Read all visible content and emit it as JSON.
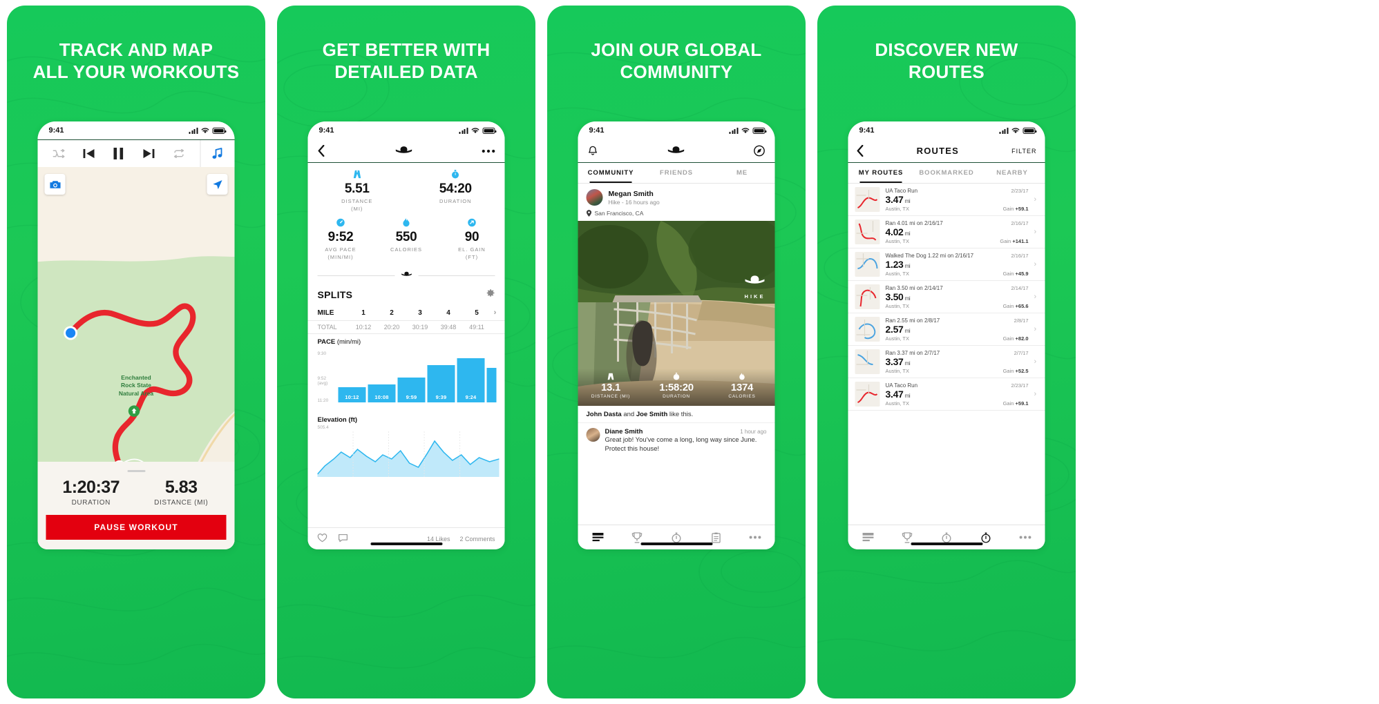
{
  "theme": {
    "brand_green": "#17c95a",
    "accent_blue": "#2eb7ef",
    "pause_red": "#e3000f",
    "route_red": "#e8262d",
    "dark_green_rule": "#1e4f35"
  },
  "panels": [
    {
      "headline_line1": "TRACK AND MAP",
      "headline_line2": "ALL YOUR WORKOUTS",
      "status_time": "9:41",
      "media_controls": [
        "shuffle-icon",
        "previous-track-icon",
        "pause-icon",
        "next-track-icon",
        "repeat-icon",
        "music-note-icon"
      ],
      "map": {
        "park_label_line1": "Enchanted",
        "park_label_line2": "Rock State",
        "park_label_line3": "Natural Area",
        "camera_button": "camera-icon",
        "locate_button": "navigate-icon"
      },
      "stats": [
        {
          "value": "1:20:37",
          "label": "DURATION"
        },
        {
          "value": "5.83",
          "label": "DISTANCE (MI)"
        }
      ],
      "pause_button": "PAUSE WORKOUT"
    },
    {
      "headline_line1": "GET BETTER WITH",
      "headline_line2": "DETAILED DATA",
      "status_time": "9:41",
      "nav": {
        "back": "back-chevron-icon",
        "logo": "under-armour-logo",
        "more": "more-dots-icon"
      },
      "summary_top": [
        {
          "icon": "road-icon",
          "value": "5.51",
          "label1": "DISTANCE",
          "label2": "(MI)"
        },
        {
          "icon": "stopwatch-icon",
          "value": "54:20",
          "label1": "DURATION",
          "label2": ""
        }
      ],
      "summary_mid": [
        {
          "icon": "speedometer-icon",
          "value": "9:52",
          "label1": "AVG PACE",
          "label2": "(MIN/MI)"
        },
        {
          "icon": "flame-icon",
          "value": "550",
          "label1": "CALORIES",
          "label2": ""
        },
        {
          "icon": "elevation-icon",
          "value": "90",
          "label1": "EL. GAIN",
          "label2": "(FT)"
        }
      ],
      "splits": {
        "title": "SPLITS",
        "settings_icon": "gear-icon",
        "header_label": "MILE",
        "columns": [
          "1",
          "2",
          "3",
          "4",
          "5"
        ],
        "total_label": "TOTAL",
        "totals": [
          "10:12",
          "20:20",
          "30:19",
          "39:48",
          "49:11"
        ],
        "pace_title": "PACE",
        "pace_unit": "(min/mi)",
        "y_ticks": [
          "9:30",
          "9:52 (avg)",
          "11:20"
        ],
        "bar_labels": [
          "10:12",
          "10:08",
          "9:59",
          "9:39",
          "9:24"
        ],
        "elevation_title": "Elevation",
        "elevation_unit": "(ft)",
        "elevation_tick": "505.4"
      },
      "action_bar": {
        "like_icon": "heart-icon",
        "comment_icon": "speech-bubble-icon",
        "likes": "14 Likes",
        "comments": "2 Comments"
      }
    },
    {
      "headline_line1": "JOIN OUR GLOBAL",
      "headline_line2": "COMMUNITY",
      "status_time": "9:41",
      "nav": {
        "bell": "notification-bell-icon",
        "logo": "under-armour-logo",
        "compass": "compass-icon"
      },
      "tabs": [
        {
          "label": "COMMUNITY",
          "active": true
        },
        {
          "label": "FRIENDS",
          "active": false
        },
        {
          "label": "ME",
          "active": false
        }
      ],
      "post": {
        "author": "Megan Smith",
        "meta": "Hike - 16 hours ago",
        "location": "San Francisco, CA",
        "photo_badge": "HIKE",
        "photo_stats": [
          {
            "icon": "road-icon",
            "value": "13.1",
            "label": "DISTANCE (MI)"
          },
          {
            "icon": "stopwatch-icon",
            "value": "1:58:20",
            "label": "DURATION"
          },
          {
            "icon": "flame-icon",
            "value": "1374",
            "label": "CALORIES"
          }
        ],
        "likes_prefix": "John Dasta",
        "likes_join": " and ",
        "likes_second": "Joe Smith",
        "likes_suffix": " like this.",
        "comment": {
          "author": "Diane Smith",
          "time": "1 hour ago",
          "text": "Great job! You've come a long, long way since June. Protect this house!"
        }
      },
      "tab_bar": [
        "feed-icon",
        "trophy-icon",
        "stopwatch-icon",
        "clipboard-icon",
        "more-dots-icon"
      ]
    },
    {
      "headline_line1": "DISCOVER NEW",
      "headline_line2": "ROUTES",
      "status_time": "9:41",
      "nav": {
        "back": "back-chevron-icon",
        "title": "ROUTES",
        "filter": "FILTER"
      },
      "tabs": [
        {
          "label": "MY ROUTES",
          "active": true
        },
        {
          "label": "BOOKMARKED",
          "active": false
        },
        {
          "label": "NEARBY",
          "active": false
        }
      ],
      "routes": [
        {
          "name": "UA Taco Run",
          "date": "2/23/17",
          "distance": "3.47",
          "unit": "mi",
          "city": "Austin, TX",
          "gain_label": "Gain ",
          "gain": "+59.1"
        },
        {
          "name": "Ran 4.01 mi on 2/16/17",
          "date": "2/16/17",
          "distance": "4.02",
          "unit": "mi",
          "city": "Austin, TX",
          "gain_label": "Gain ",
          "gain": "+141.1"
        },
        {
          "name": "Walked The Dog 1.22 mi on 2/16/17",
          "date": "2/16/17",
          "distance": "1.23",
          "unit": "mi",
          "city": "Austin, TX",
          "gain_label": "Gain ",
          "gain": "+45.9"
        },
        {
          "name": "Ran 3.50 mi on 2/14/17",
          "date": "2/14/17",
          "distance": "3.50",
          "unit": "mi",
          "city": "Austin, TX",
          "gain_label": "Gain ",
          "gain": "+65.6"
        },
        {
          "name": "Ran 2.55 mi on 2/8/17",
          "date": "2/8/17",
          "distance": "2.57",
          "unit": "mi",
          "city": "Austin, TX",
          "gain_label": "Gain ",
          "gain": "+82.0"
        },
        {
          "name": "Ran 3.37 mi on 2/7/17",
          "date": "2/7/17",
          "distance": "3.37",
          "unit": "mi",
          "city": "Austin, TX",
          "gain_label": "Gain ",
          "gain": "+52.5"
        },
        {
          "name": "UA Taco Run",
          "date": "2/23/17",
          "distance": "3.47",
          "unit": "mi",
          "city": "Austin, TX",
          "gain_label": "Gain ",
          "gain": "+59.1"
        }
      ],
      "tab_bar": [
        "feed-icon",
        "trophy-icon",
        "stopwatch-icon",
        "route-icon",
        "more-dots-icon"
      ]
    }
  ],
  "chart_data": [
    {
      "type": "bar",
      "title": "PACE",
      "ylabel": "(min/mi)",
      "categories": [
        "1",
        "2",
        "3",
        "4",
        "5"
      ],
      "values": [
        "10:12",
        "10:08",
        "9:59",
        "9:39",
        "9:24"
      ],
      "y_ticks": [
        "9:30",
        "9:52 (avg)",
        "11:20"
      ],
      "xlabel": "MILE",
      "legend": "none",
      "grid": false
    },
    {
      "type": "area",
      "title": "Elevation",
      "ylabel": "(ft)",
      "y_ticks": [
        "505.4"
      ],
      "x": [
        0,
        1,
        2,
        3,
        4,
        5,
        6,
        7,
        8,
        9,
        10,
        11,
        12,
        13,
        14,
        15,
        16,
        17,
        18,
        19,
        20
      ],
      "values": [
        12,
        22,
        38,
        30,
        44,
        35,
        26,
        20,
        33,
        29,
        41,
        24,
        18,
        36,
        58,
        40,
        27,
        33,
        22,
        30,
        25
      ],
      "grid": false
    }
  ]
}
